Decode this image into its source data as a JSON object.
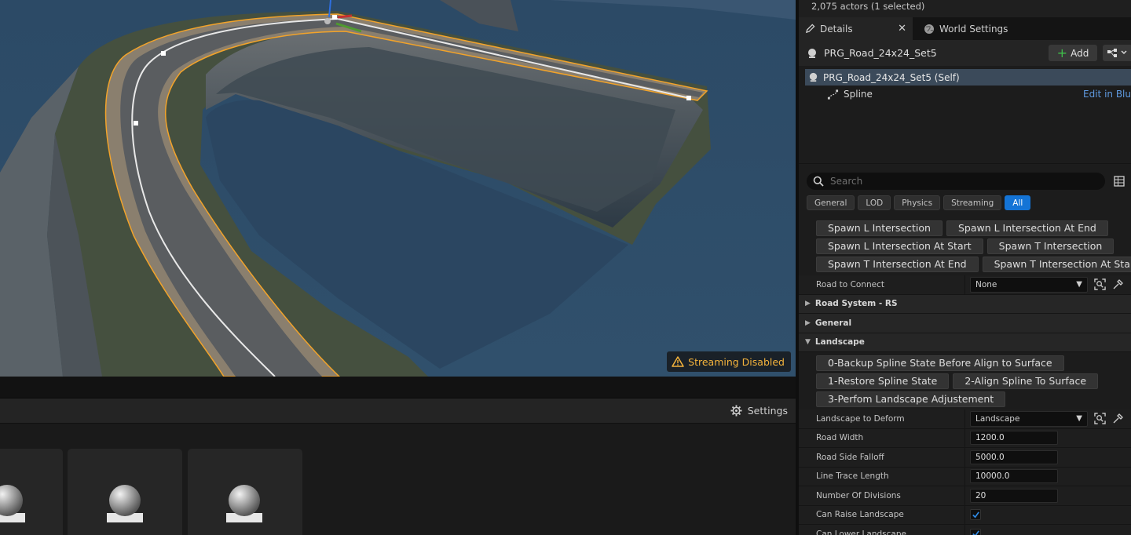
{
  "viewport": {
    "streaming_label": "Streaming Disabled"
  },
  "content_browser": {
    "settings_label": "Settings"
  },
  "outliner": {
    "actor_count": "2,075 actors (1 selected)"
  },
  "tabs": [
    {
      "label": "Details"
    },
    {
      "label": "World Settings"
    }
  ],
  "actor": {
    "name": "PRG_Road_24x24_Set5",
    "add_label": "Add",
    "self_label": "PRG_Road_24x24_Set5 (Self)",
    "components": [
      {
        "label": "Spline"
      }
    ],
    "edit_blueprint_label": "Edit in Blu"
  },
  "search": {
    "placeholder": "Search"
  },
  "filters": [
    {
      "label": "General"
    },
    {
      "label": "LOD"
    },
    {
      "label": "Physics"
    },
    {
      "label": "Streaming"
    },
    {
      "label": "All",
      "active": true
    }
  ],
  "function_buttons_top": [
    [
      "Spawn L Intersection",
      "Spawn L Intersection At End"
    ],
    [
      "Spawn L Intersection At Start",
      "Spawn T Intersection"
    ],
    [
      "Spawn T Intersection At End",
      "Spawn T Intersection At Start"
    ]
  ],
  "road_to_connect": {
    "label": "Road to Connect",
    "value": "None"
  },
  "categories": {
    "road_system": "Road System - RS",
    "general": "General",
    "landscape": "Landscape"
  },
  "landscape_buttons": [
    [
      "0-Backup Spline State Before Align to Surface"
    ],
    [
      "1-Restore Spline State",
      "2-Align Spline To Surface"
    ],
    [
      "3-Perfom Landscape Adjustement"
    ]
  ],
  "landscape_to_deform": {
    "label": "Landscape to Deform",
    "value": "Landscape"
  },
  "landscape_props": [
    {
      "label": "Road Width",
      "value": "1200.0"
    },
    {
      "label": "Road Side Falloff",
      "value": "5000.0"
    },
    {
      "label": "Line Trace Length",
      "value": "10000.0"
    },
    {
      "label": "Number Of Divisions",
      "value": "20"
    }
  ],
  "landscape_checks": [
    {
      "label": "Can Raise Landscape",
      "checked": true
    },
    {
      "label": "Can Lower Landscape",
      "checked": true
    }
  ],
  "colors": {
    "accent": "#1474d6",
    "warning": "#f4b33c",
    "selection_outline": "#f2a32a",
    "link": "#5f9ae0"
  }
}
